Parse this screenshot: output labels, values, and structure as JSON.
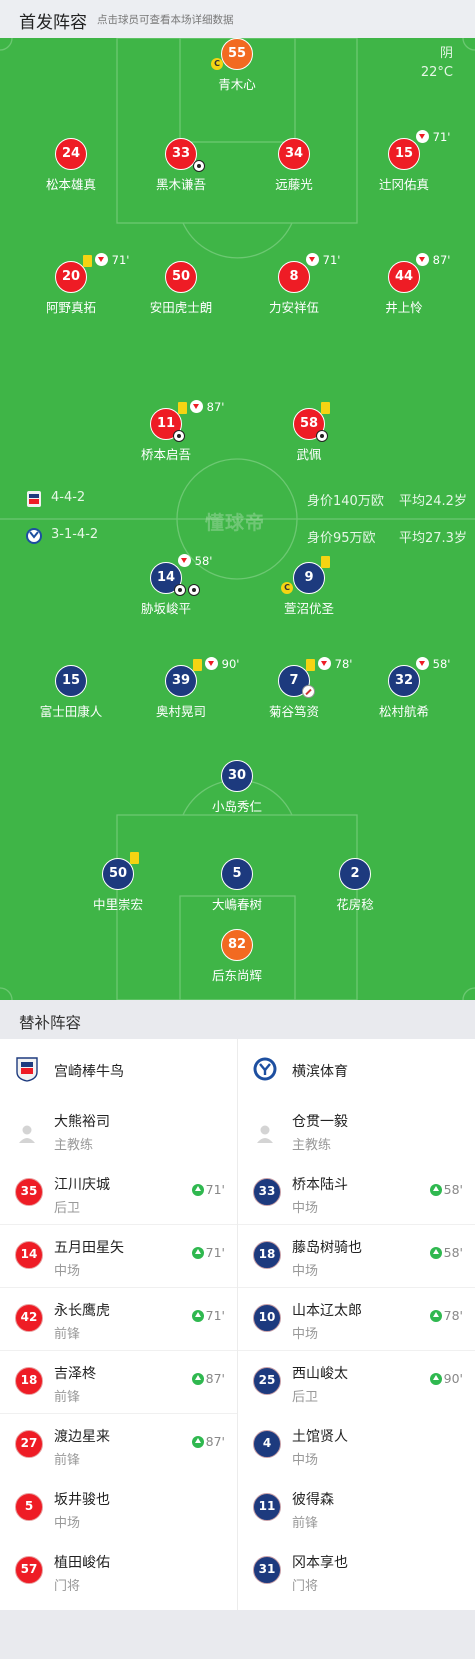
{
  "header": {
    "title": "首发阵容",
    "subtitle": "点击球员可查看本场详细数据"
  },
  "weather": {
    "condition": "阴",
    "temperature": "22°C"
  },
  "teams": {
    "home": {
      "formation": "4-4-2",
      "market_value": "身价140万欧",
      "avg_age": "平均24.2岁"
    },
    "away": {
      "formation": "3-1-4-2",
      "market_value": "身价95万欧",
      "avg_age": "平均27.3岁"
    }
  },
  "watermark": "懂球帝",
  "lineup": {
    "home": [
      {
        "num": "55",
        "name": "青木心",
        "captain": true
      },
      {
        "num": "24",
        "name": "松本雄真"
      },
      {
        "num": "33",
        "name": "黑木谦吾",
        "goals": 1
      },
      {
        "num": "34",
        "name": "远藤光"
      },
      {
        "num": "15",
        "name": "辻冈佑真",
        "sub_off": "71'"
      },
      {
        "num": "20",
        "name": "阿野真拓",
        "sub_off": "71'",
        "yellow": true
      },
      {
        "num": "50",
        "name": "安田虎士朗"
      },
      {
        "num": "8",
        "name": "力安祥伍",
        "sub_off": "71'"
      },
      {
        "num": "44",
        "name": "井上怜",
        "sub_off": "87'"
      },
      {
        "num": "11",
        "name": "桥本启吾",
        "sub_off": "87'",
        "yellow": true,
        "goals": 1
      },
      {
        "num": "58",
        "name": "武佩",
        "yellow": true,
        "goals": 1
      }
    ],
    "away": [
      {
        "num": "14",
        "name": "胁坂峻平",
        "sub_off": "58'",
        "goals": 2
      },
      {
        "num": "9",
        "name": "萱沼优圣",
        "yellow": true,
        "captain": true
      },
      {
        "num": "15",
        "name": "富士田康人"
      },
      {
        "num": "39",
        "name": "奥村晃司",
        "sub_off": "90'",
        "yellow": true
      },
      {
        "num": "7",
        "name": "菊谷笃资",
        "sub_off": "78'",
        "yellow": true,
        "injury": true
      },
      {
        "num": "32",
        "name": "松村航希",
        "sub_off": "58'"
      },
      {
        "num": "30",
        "name": "小岛秀仁"
      },
      {
        "num": "50",
        "name": "中里崇宏",
        "yellow": true
      },
      {
        "num": "5",
        "name": "大嶋春树"
      },
      {
        "num": "2",
        "name": "花房稔"
      },
      {
        "num": "82",
        "name": "后东尚辉"
      }
    ]
  },
  "subs_section": {
    "title": "替补阵容",
    "home": {
      "team": "宫崎棒牛鸟",
      "coach": {
        "name": "大熊裕司",
        "role": "主教练"
      },
      "players": [
        {
          "num": "35",
          "name": "江川庆城",
          "pos": "后卫",
          "on": "71'"
        },
        {
          "num": "14",
          "name": "五月田星矢",
          "pos": "中场",
          "on": "71'"
        },
        {
          "num": "42",
          "name": "永长鹰虎",
          "pos": "前锋",
          "on": "71'"
        },
        {
          "num": "18",
          "name": "吉泽柊",
          "pos": "前锋",
          "on": "87'"
        },
        {
          "num": "27",
          "name": "渡边星来",
          "pos": "前锋",
          "on": "87'"
        },
        {
          "num": "5",
          "name": "坂井骏也",
          "pos": "中场"
        },
        {
          "num": "57",
          "name": "植田峻佑",
          "pos": "门将"
        }
      ]
    },
    "away": {
      "team": "横滨体育",
      "coach": {
        "name": "仓贯一毅",
        "role": "主教练"
      },
      "players": [
        {
          "num": "33",
          "name": "桥本陆斗",
          "pos": "中场",
          "on": "58'"
        },
        {
          "num": "18",
          "name": "藤岛树骑也",
          "pos": "中场",
          "on": "58'"
        },
        {
          "num": "10",
          "name": "山本辽太郎",
          "pos": "中场",
          "on": "78'"
        },
        {
          "num": "25",
          "name": "西山峻太",
          "pos": "后卫",
          "on": "90'"
        },
        {
          "num": "4",
          "name": "土馆贤人",
          "pos": "中场"
        },
        {
          "num": "11",
          "name": "彼得森",
          "pos": "前锋"
        },
        {
          "num": "31",
          "name": "冈本享也",
          "pos": "门将"
        }
      ]
    }
  }
}
